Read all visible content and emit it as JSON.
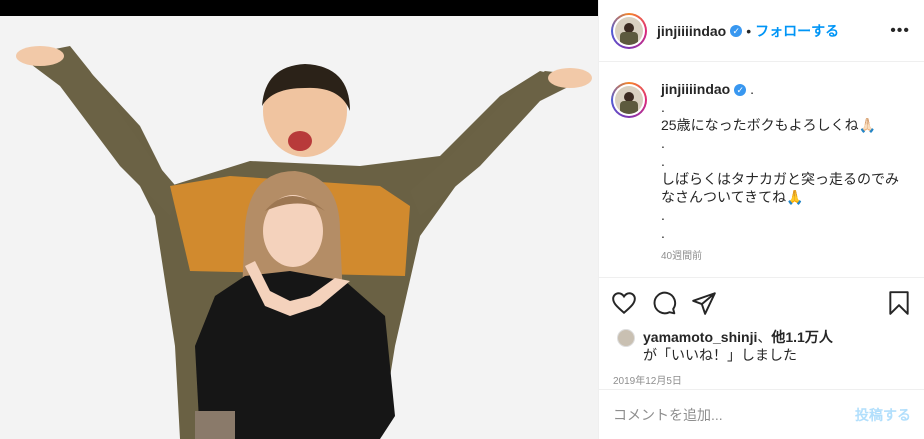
{
  "post": {
    "username": "jinjiiiindao",
    "verified_mark": "✓",
    "separator": "•",
    "follow_label": "フォローする",
    "more_label": "•••"
  },
  "caption": {
    "username": "jinjiiiindao",
    "lines": [
      ".",
      ".",
      "25歳になったボクもよろしくね🙏🏻",
      ".",
      ".",
      "しばらくはタナカガと突っ走るのでみ",
      "なさんついてきてね🙏",
      ".",
      "."
    ],
    "time_partial": "40週間前"
  },
  "actions": {
    "like_icon": "heart-icon",
    "comment_icon": "comment-icon",
    "share_icon": "share-icon",
    "save_icon": "bookmark-icon"
  },
  "likes": {
    "user": "yamamoto_shinji",
    "sep": "、",
    "count": "他1.1万人",
    "suffix": "が「いいね！」しました"
  },
  "date": "2019年12月5日",
  "comment": {
    "placeholder": "コメントを追加...",
    "post_label": "投稿する"
  },
  "colors": {
    "accent": "#0095f6",
    "post_disabled": "#b2dffc",
    "muted": "#8e8e8e"
  }
}
